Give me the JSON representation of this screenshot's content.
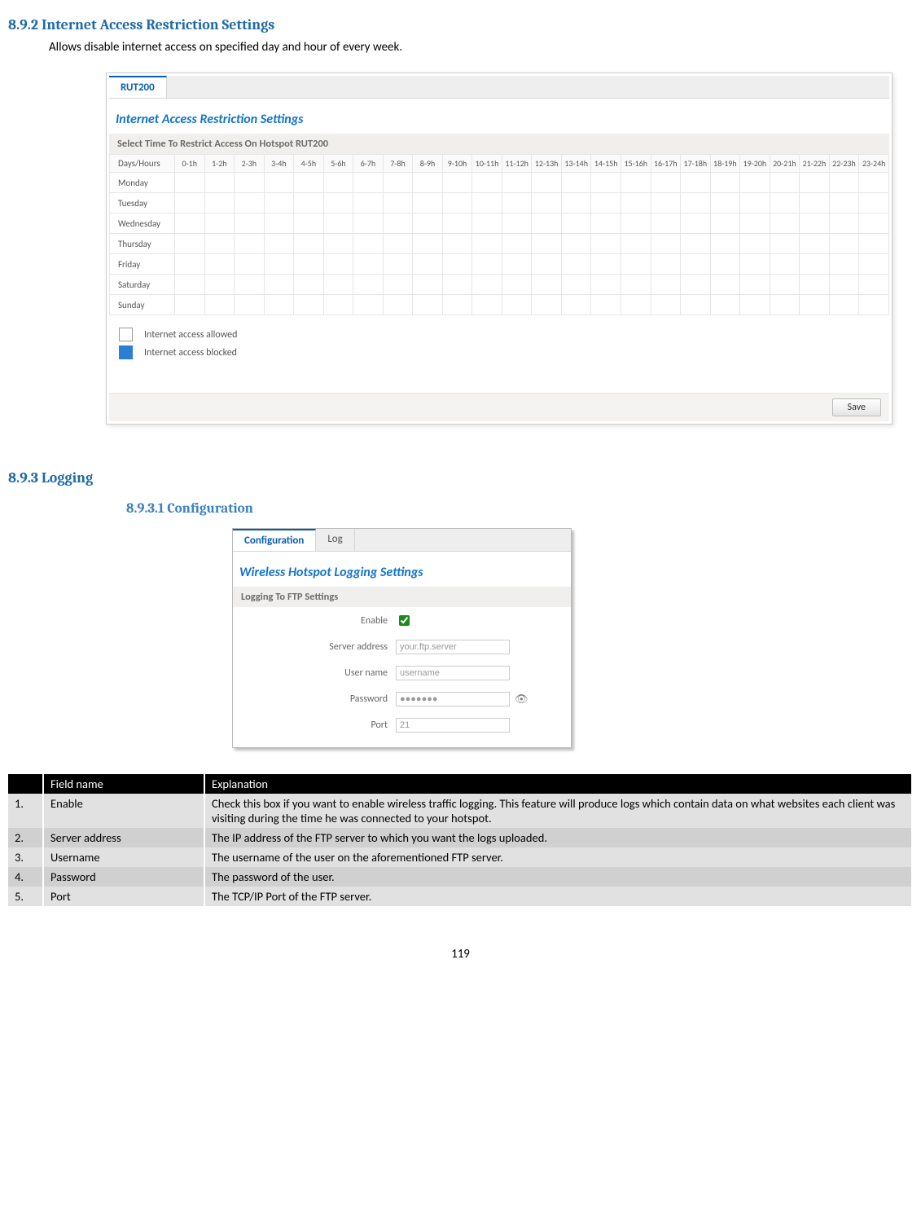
{
  "heading1": "8.9.2 Internet Access Restriction Settings",
  "intro": "Allows disable internet access on specified day and hour of every week.",
  "tab_rut200": "RUT200",
  "panel1_title": "Internet Access Restriction Settings",
  "panel1_sub": "Select Time To Restrict Access On Hotspot RUT200",
  "row_header": "Days/Hours",
  "hours": [
    "0-1h",
    "1-2h",
    "2-3h",
    "3-4h",
    "4-5h",
    "5-6h",
    "6-7h",
    "7-8h",
    "8-9h",
    "9-10h",
    "10-11h",
    "11-12h",
    "12-13h",
    "13-14h",
    "14-15h",
    "15-16h",
    "16-17h",
    "17-18h",
    "18-19h",
    "19-20h",
    "20-21h",
    "21-22h",
    "22-23h",
    "23-24h"
  ],
  "days": [
    "Monday",
    "Tuesday",
    "Wednesday",
    "Thursday",
    "Friday",
    "Saturday",
    "Sunday"
  ],
  "legend_allowed": "Internet access allowed",
  "legend_blocked": "Internet access blocked",
  "save_label": "Save",
  "heading2": "8.9.3 Logging",
  "heading3": "8.9.3.1   Configuration",
  "tab_config": "Configuration",
  "tab_log": "Log",
  "panel2_title": "Wireless Hotspot Logging Settings",
  "panel2_sub": "Logging To FTP Settings",
  "form": {
    "enable_label": "Enable",
    "server_label": "Server address",
    "server_value": "your.ftp.server",
    "user_label": "User name",
    "user_value": "username",
    "pass_label": "Password",
    "pass_value": "●●●●●●●",
    "port_label": "Port",
    "port_value": "21"
  },
  "defs": {
    "h_num": "",
    "h_field": "Field name",
    "h_exp": "Explanation",
    "rows": [
      {
        "n": "1.",
        "f": "Enable",
        "e": "Check this box if you want to enable wireless traffic logging. This feature will produce logs which contain data on what websites each client was visiting during the time he was connected to your hotspot."
      },
      {
        "n": "2.",
        "f": "Server address",
        "e": "The IP address of the FTP server to which you want the logs uploaded."
      },
      {
        "n": "3.",
        "f": "Username",
        "e": "The username of the user on the aforementioned FTP server."
      },
      {
        "n": "4.",
        "f": "Password",
        "e": "The password of the user."
      },
      {
        "n": "5.",
        "f": "Port",
        "e": "The TCP/IP Port of the FTP server."
      }
    ]
  },
  "page_number": "119"
}
